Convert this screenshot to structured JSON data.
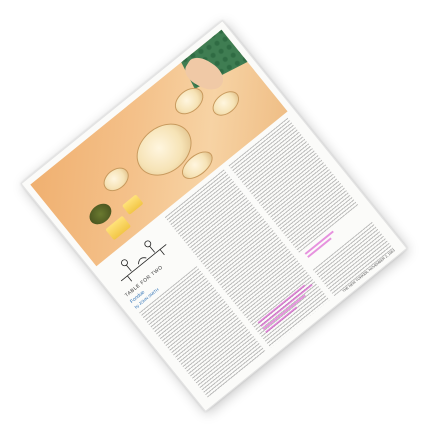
{
  "document": {
    "kicker": "TABLE FOR TWO",
    "title": "Fondue",
    "byline": "by JOHN SMITH",
    "folio": "THE NEW YORKER, NOVEMBER 2, 1963"
  },
  "colors": {
    "headline_blue": "#2b6fb4",
    "highlight_magenta": "#d63cc8",
    "photo_orange": "#f0b070"
  }
}
